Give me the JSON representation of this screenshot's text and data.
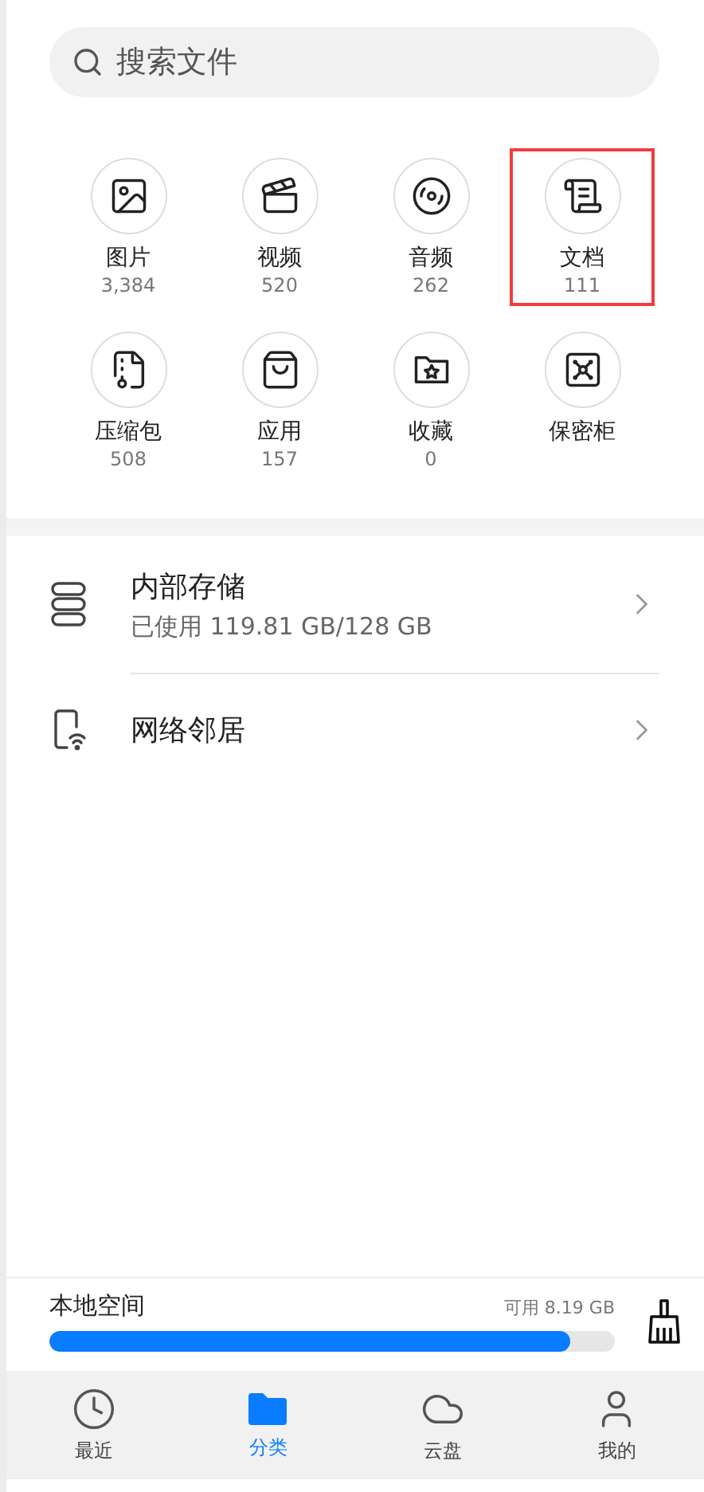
{
  "search": {
    "placeholder": "搜索文件"
  },
  "categories": [
    {
      "label": "图片",
      "count": "3,384",
      "highlighted": false
    },
    {
      "label": "视频",
      "count": "520",
      "highlighted": false
    },
    {
      "label": "音频",
      "count": "262",
      "highlighted": false
    },
    {
      "label": "文档",
      "count": "111",
      "highlighted": true
    },
    {
      "label": "压缩包",
      "count": "508",
      "highlighted": false
    },
    {
      "label": "应用",
      "count": "157",
      "highlighted": false
    },
    {
      "label": "收藏",
      "count": "0",
      "highlighted": false
    },
    {
      "label": "保密柜",
      "highlighted": false
    }
  ],
  "locations": [
    {
      "title": "内部存储",
      "subtitle": "已使用 119.81 GB/128 GB"
    },
    {
      "title": "网络邻居"
    }
  ],
  "local_space": {
    "label": "本地空间",
    "available": "可用 8.19 GB",
    "level": 0.92
  },
  "tabs": [
    {
      "label": "最近",
      "selected": false
    },
    {
      "label": "分类",
      "selected": true
    },
    {
      "label": "云盘",
      "selected": false
    },
    {
      "label": "我的",
      "selected": false
    }
  ]
}
